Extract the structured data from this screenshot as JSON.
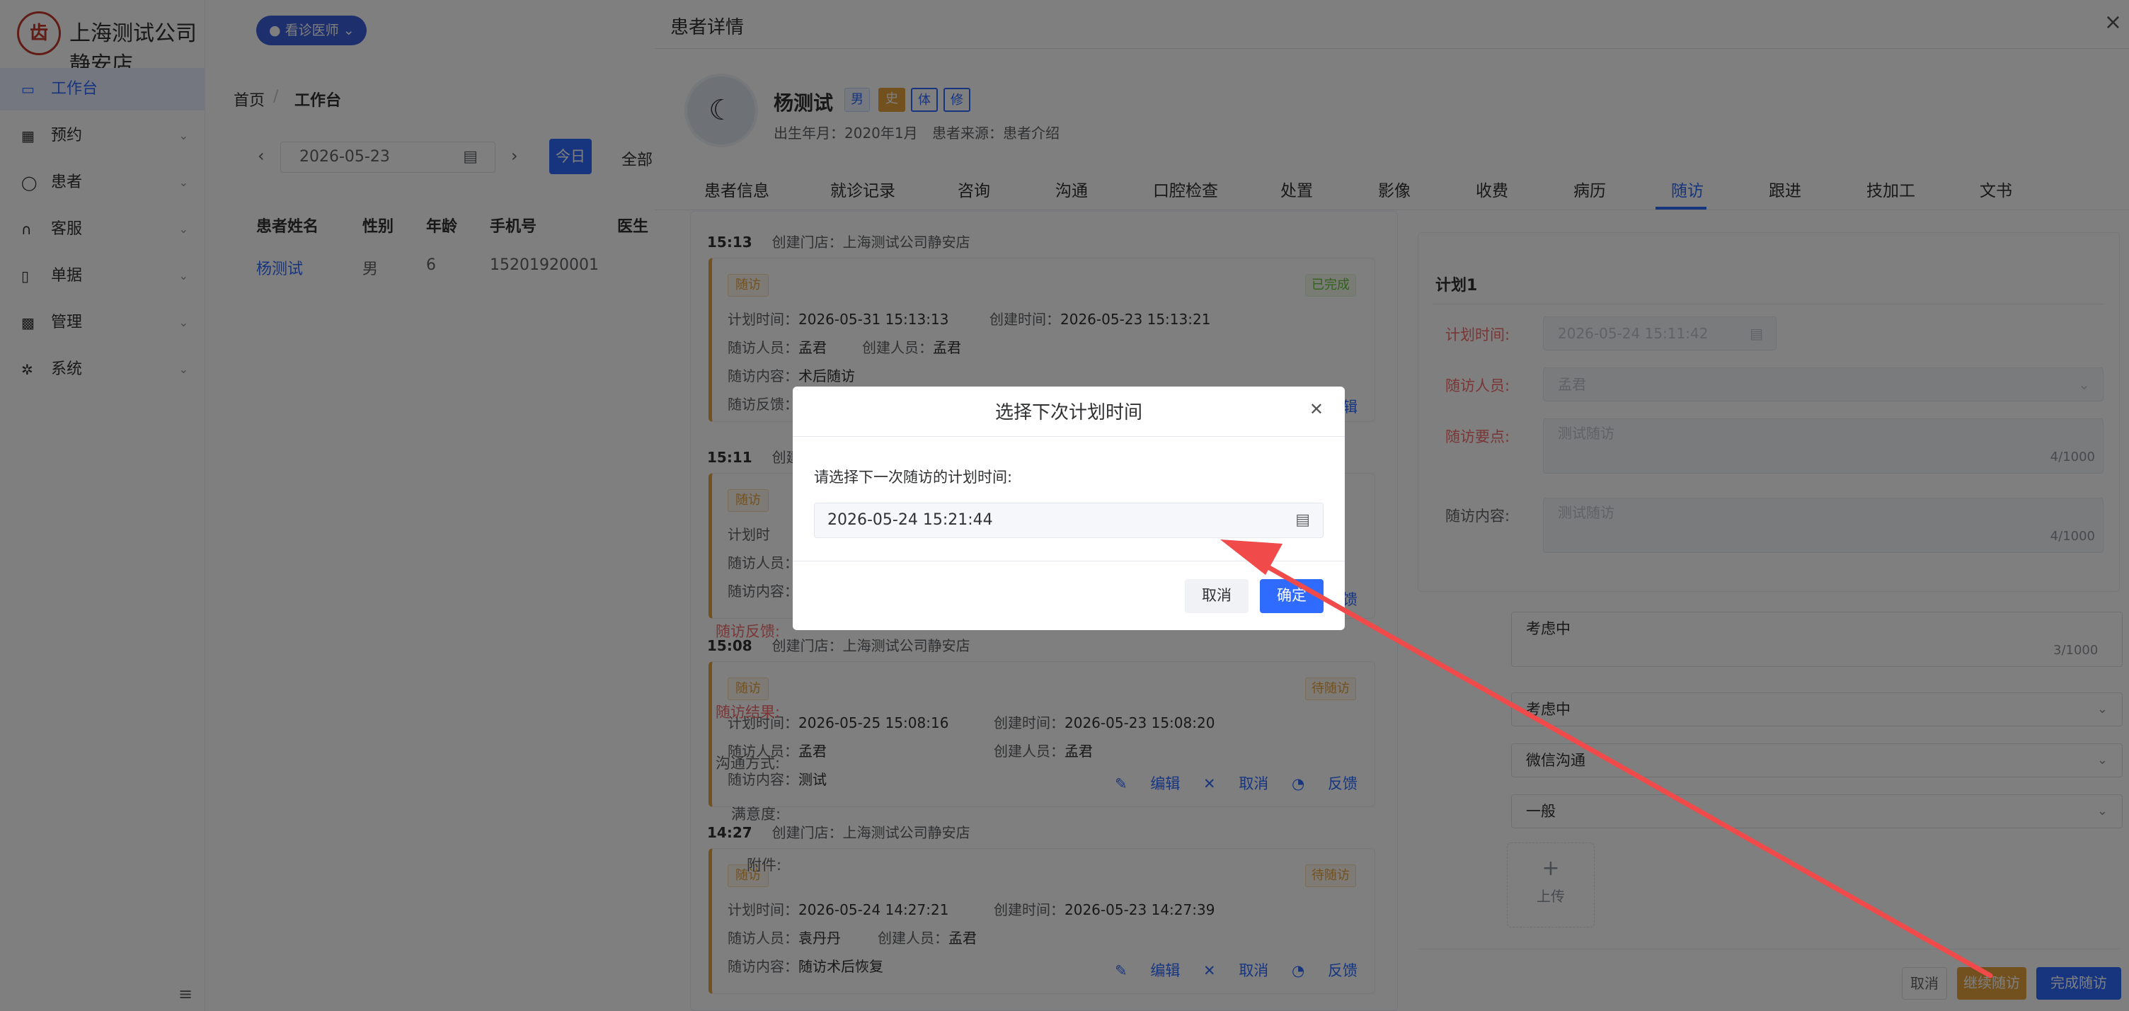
{
  "app": {
    "brand": "上海测试公司静安店",
    "role": "看诊医师",
    "nav": [
      {
        "label": "工作台",
        "icon": "monitor-icon"
      },
      {
        "label": "预约",
        "icon": "calendar-icon"
      },
      {
        "label": "患者",
        "icon": "user-icon"
      },
      {
        "label": "客服",
        "icon": "headset-icon"
      },
      {
        "label": "单据",
        "icon": "receipt-icon"
      },
      {
        "label": "管理",
        "icon": "grid-icon"
      },
      {
        "label": "系统",
        "icon": "gear-icon"
      }
    ],
    "breadcrumb": [
      "首页",
      "工作台"
    ],
    "date": "2026-05-23",
    "today_btn": "今日",
    "filter_all": "全部",
    "table": {
      "headers": [
        "患者姓名",
        "性别",
        "年龄",
        "手机号",
        "医生"
      ],
      "row": [
        "杨测试",
        "男",
        "6",
        "15201920001"
      ]
    }
  },
  "drawer": {
    "title": "患者详情",
    "patient": {
      "name": "杨测试",
      "tags": [
        "男",
        "史",
        "体",
        "修"
      ],
      "birth": "出生年月：2020年1月",
      "source": "患者来源：患者介绍"
    },
    "tabs": [
      "患者信息",
      "就诊记录",
      "咨询",
      "沟通",
      "口腔检查",
      "处置",
      "影像",
      "收费",
      "病历",
      "随访",
      "跟进",
      "技加工",
      "文书"
    ],
    "records": [
      {
        "time": "15:13",
        "store": "创建门店：上海测试公司静安店",
        "badge": "随访",
        "status": "已完成",
        "plan": "计划时间：",
        "plan_v": "2026-05-31 15:13:13",
        "created": "创建时间：",
        "created_v": "2026-05-23 15:13:21",
        "staff": "随访人员：",
        "staff_v": "孟君",
        "creator": "创建人员：",
        "creator_v": "孟君",
        "content": "随访内容：",
        "content_v": "术后随访",
        "feedback": "随访反馈：",
        "edit_tail": "辑"
      },
      {
        "time": "15:11",
        "store": "创建门",
        "badge": "随访",
        "plan": "计划时",
        "staff": "随访人员：",
        "content": "随访内容：",
        "feedback_tail": "馈"
      },
      {
        "time": "15:08",
        "store": "创建门店：上海测试公司静安店",
        "badge": "随访",
        "status": "待随访",
        "plan": "计划时间：",
        "plan_v": "2026-05-25 15:08:16",
        "created": "创建时间：",
        "created_v": "2026-05-23 15:08:20",
        "staff": "随访人员：",
        "staff_v": "孟君",
        "creator": "创建人员：",
        "creator_v": "孟君",
        "content": "随访内容：",
        "content_v": "测试",
        "actions": [
          "编辑",
          "取消",
          "反馈"
        ]
      },
      {
        "time": "14:27",
        "store": "创建门店：上海测试公司静安店",
        "badge": "随访",
        "status": "待随访",
        "plan": "计划时间：",
        "plan_v": "2026-05-24 14:27:21",
        "created": "创建时间：",
        "created_v": "2026-05-23 14:27:39",
        "staff": "随访人员：",
        "staff_v": "袁丹丹",
        "creator": "创建人员：",
        "creator_v": "孟君",
        "content": "随访内容：",
        "content_v": "随访术后恢复",
        "actions": [
          "编辑",
          "取消",
          "反馈"
        ]
      }
    ],
    "plan": {
      "title": "计划1",
      "time_label": "计划时间:",
      "time_value": "2026-05-24 15:11:42",
      "staff_label": "随访人员:",
      "staff_value": "孟君",
      "points_label": "随访要点:",
      "points_value": "测试随访",
      "points_count": "4/1000",
      "content_label": "随访内容:",
      "content_value": "测试随访",
      "content_count": "4/1000"
    },
    "form": {
      "feedback_label": "随访反馈:",
      "feedback_value": "考虑中",
      "feedback_count": "3/1000",
      "result_label": "随访结果:",
      "result_value": "考虑中",
      "method_label": "沟通方式:",
      "method_value": "微信沟通",
      "satisfaction_label": "满意度:",
      "satisfaction_value": "一般",
      "attachment_label": "附件:",
      "upload_label": "上传"
    },
    "footer": {
      "cancel": "取消",
      "continue": "继续随访",
      "complete": "完成随访"
    }
  },
  "dialog": {
    "title": "选择下次计划时间",
    "prompt": "请选择下一次随访的计划时间:",
    "value": "2026-05-24 15:21:44",
    "cancel": "取消",
    "confirm": "确定"
  },
  "colors": {
    "primary": "#2f6bff",
    "warning": "#e6a23c",
    "success": "#67c23a",
    "danger": "#f56c6c",
    "annotation_arrow": "#f04a4a"
  }
}
